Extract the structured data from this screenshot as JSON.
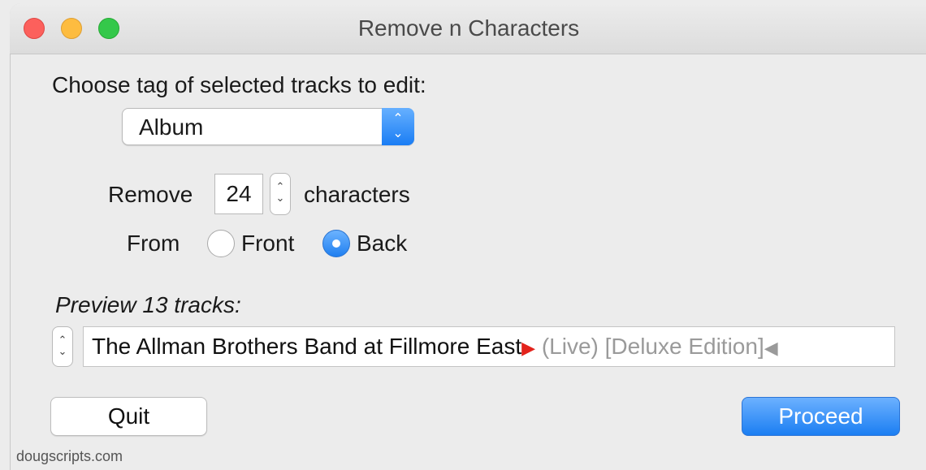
{
  "window": {
    "title": "Remove n Characters",
    "controls": [
      "close-button",
      "minimize-button",
      "zoom-button"
    ],
    "colors": {
      "close": "#fc605c",
      "minimize": "#fdbc40",
      "zoom": "#34c84a"
    }
  },
  "tag_section": {
    "prompt": "Choose tag of selected tracks to edit:",
    "selected_tag": "Album",
    "arrows_icon": "up-down-chevron-icon"
  },
  "remove_section": {
    "prefix": "Remove",
    "count": "24",
    "suffix": "characters"
  },
  "from_section": {
    "label": "From",
    "options": [
      {
        "label": "Front",
        "selected": false
      },
      {
        "label": "Back",
        "selected": true
      }
    ]
  },
  "preview": {
    "heading": "Preview 13 tracks:",
    "kept_text": "The Allman Brothers Band at Fillmore East",
    "start_marker": "▶",
    "removed_text": " (Live) [Deluxe Edition]",
    "end_marker": "◀",
    "colors": {
      "start_marker": "#e3231c",
      "removed_text": "#9a9a9a"
    }
  },
  "buttons": {
    "quit": "Quit",
    "proceed": "Proceed",
    "accent": "#1b7ef2"
  },
  "footer": {
    "credit": "dougscripts.com"
  }
}
